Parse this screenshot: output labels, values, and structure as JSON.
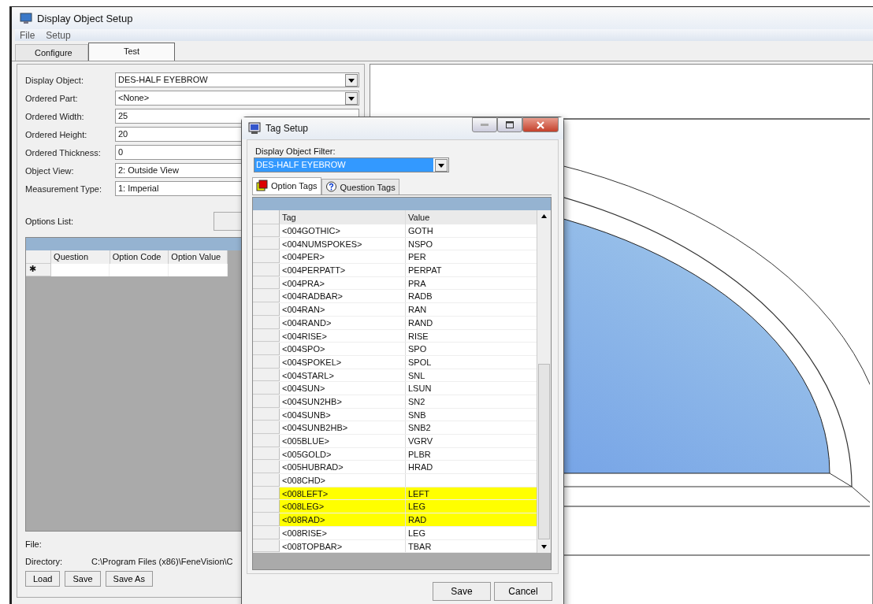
{
  "window": {
    "title": "Display Object Setup"
  },
  "menu": [
    "File",
    "Setup"
  ],
  "tabs": [
    {
      "label": "Configure",
      "selected": false
    },
    {
      "label": "Test",
      "selected": true
    }
  ],
  "form": [
    {
      "label": "Display Object:",
      "value": "DES-HALF EYEBROW",
      "kind": "dropdown"
    },
    {
      "label": "Ordered Part:",
      "value": "<None>",
      "kind": "dropdown"
    },
    {
      "label": "Ordered Width:",
      "value": "25",
      "kind": "text"
    },
    {
      "label": "Ordered Height:",
      "value": "20",
      "kind": "text"
    },
    {
      "label": "Ordered Thickness:",
      "value": "0",
      "kind": "text"
    },
    {
      "label": "Object View:",
      "value": "2: Outside View",
      "kind": "text"
    },
    {
      "label": "Measurement Type:",
      "value": "1: Imperial",
      "kind": "text"
    }
  ],
  "options_list": {
    "label": "Options List:",
    "columns": [
      "Question",
      "Option Code",
      "Option Value"
    ],
    "new_row_marker": "✱"
  },
  "file": {
    "label": "File:"
  },
  "directory": {
    "label": "Directory:",
    "value": "C:\\Program Files (x86)\\FeneVision\\C"
  },
  "buttons": [
    "Load",
    "Save",
    "Save As"
  ],
  "dialog": {
    "title": "Tag Setup",
    "filter_label": "Display Object Filter:",
    "filter_value": "DES-HALF EYEBROW",
    "tabs": [
      {
        "label": "Option Tags",
        "selected": true
      },
      {
        "label": "Question Tags",
        "selected": false
      }
    ],
    "columns": [
      "Tag",
      "Value"
    ],
    "rows": [
      {
        "tag": "<004GOTHIC>",
        "value": "GOTH",
        "highlighted": false
      },
      {
        "tag": "<004NUMSPOKES>",
        "value": "NSPO",
        "highlighted": false
      },
      {
        "tag": "<004PER>",
        "value": "PER",
        "highlighted": false
      },
      {
        "tag": "<004PERPATT>",
        "value": "PERPAT",
        "highlighted": false
      },
      {
        "tag": "<004PRA>",
        "value": "PRA",
        "highlighted": false
      },
      {
        "tag": "<004RADBAR>",
        "value": "RADB",
        "highlighted": false
      },
      {
        "tag": "<004RAN>",
        "value": "RAN",
        "highlighted": false
      },
      {
        "tag": "<004RAND>",
        "value": "RAND",
        "highlighted": false
      },
      {
        "tag": "<004RISE>",
        "value": "RISE",
        "highlighted": false
      },
      {
        "tag": "<004SPO>",
        "value": "SPO",
        "highlighted": false
      },
      {
        "tag": "<004SPOKEL>",
        "value": "SPOL",
        "highlighted": false
      },
      {
        "tag": "<004STARL>",
        "value": "SNL",
        "highlighted": false
      },
      {
        "tag": "<004SUN>",
        "value": "LSUN",
        "highlighted": false
      },
      {
        "tag": "<004SUN2HB>",
        "value": "SN2",
        "highlighted": false
      },
      {
        "tag": "<004SUNB>",
        "value": "SNB",
        "highlighted": false
      },
      {
        "tag": "<004SUNB2HB>",
        "value": "SNB2",
        "highlighted": false
      },
      {
        "tag": "<005BLUE>",
        "value": "VGRV",
        "highlighted": false
      },
      {
        "tag": "<005GOLD>",
        "value": "PLBR",
        "highlighted": false
      },
      {
        "tag": "<005HUBRAD>",
        "value": "HRAD",
        "highlighted": false
      },
      {
        "tag": "<008CHD>",
        "value": "",
        "highlighted": false
      },
      {
        "tag": "<008LEFT>",
        "value": "LEFT",
        "highlighted": true
      },
      {
        "tag": "<008LEG>",
        "value": "LEG",
        "highlighted": true
      },
      {
        "tag": "<008RAD>",
        "value": "RAD",
        "highlighted": true
      },
      {
        "tag": "<008RISE>",
        "value": "LEG",
        "highlighted": false
      },
      {
        "tag": "<008TOPBAR>",
        "value": "TBAR",
        "highlighted": false
      }
    ],
    "buttons": [
      "Save",
      "Cancel"
    ]
  }
}
